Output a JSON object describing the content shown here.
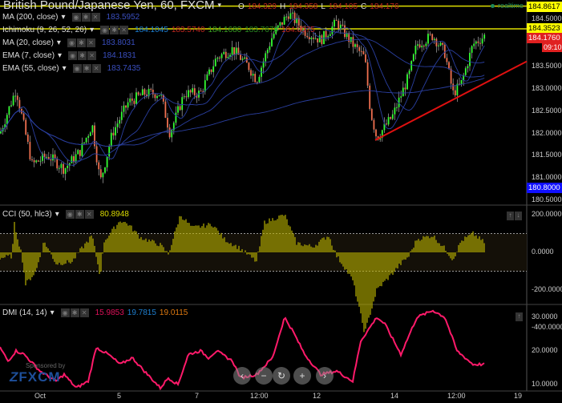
{
  "title": "British Pound/Japanese Yen, 60, FXCM",
  "ohlc": {
    "o_label": "O",
    "o": "184.329",
    "h_label": "H",
    "h": "184.358",
    "l_label": "L",
    "l": "184.105",
    "c_label": "C",
    "c": "184.176"
  },
  "realtime": "realtime",
  "indicators": [
    {
      "name": "MA (200, close)",
      "values": [
        "183.5952"
      ],
      "colors": [
        "#3a4fc0"
      ]
    },
    {
      "name": "Ichimoku (9, 26, 52, 26)",
      "values": [
        "184.1045",
        "183.5740",
        "184.1680",
        "183.7678",
        "184.0975"
      ],
      "colors": [
        "#1e7fd0",
        "#c0281e",
        "#3aa020",
        "#2a8a20",
        "#c0281e"
      ]
    },
    {
      "name": "MA (20, close)",
      "values": [
        "183.8031"
      ],
      "colors": [
        "#3a4fc0"
      ]
    },
    {
      "name": "EMA (7, close)",
      "values": [
        "184.1831"
      ],
      "colors": [
        "#3a4fc0"
      ]
    },
    {
      "name": "EMA (55, close)",
      "values": [
        "183.7435"
      ],
      "colors": [
        "#3a4fc0"
      ]
    }
  ],
  "price_axis": [
    "184.5000",
    "183.5000",
    "183.0000",
    "182.5000",
    "182.0000",
    "181.5000",
    "181.0000",
    "180.5000"
  ],
  "price_tags": {
    "high_line": "184.8617",
    "resistance": "184.3523",
    "last": "184.1760",
    "countdown": "09:10",
    "low": "180.8000"
  },
  "cci": {
    "name": "CCI (50, hlc3)",
    "value": "80.8948",
    "axis": [
      "200.0000",
      "0.0000",
      "-200.0000",
      "-400.0000"
    ]
  },
  "dmi": {
    "name": "DMI (14, 14)",
    "values": [
      "15.9853",
      "19.7815",
      "19.0115"
    ],
    "colors": [
      "#e0105a",
      "#1e7fd0",
      "#e07a10"
    ],
    "axis": [
      "30.0000",
      "20.0000",
      "10.0000"
    ]
  },
  "x_axis": [
    "Oct",
    "5",
    "7",
    "12:00",
    "12",
    "14",
    "12:00",
    "19"
  ],
  "sponsor": {
    "text": "Sponsored by",
    "brand": "FXCM"
  },
  "nav_buttons": [
    "‹",
    "−",
    "↻",
    "+",
    "›"
  ],
  "chart_data": {
    "type": "candlestick",
    "price_close": [
      [
        0,
        182
      ],
      [
        20,
        183
      ],
      [
        40,
        181.3
      ],
      [
        60,
        181.5
      ],
      [
        80,
        181.2
      ],
      [
        100,
        181.6
      ],
      [
        115,
        182.2
      ],
      [
        125,
        180.9
      ],
      [
        140,
        182
      ],
      [
        160,
        182.7
      ],
      [
        180,
        182.9
      ],
      [
        200,
        182.9
      ],
      [
        212,
        182
      ],
      [
        230,
        182.9
      ],
      [
        250,
        182.9
      ],
      [
        270,
        183.7
      ],
      [
        290,
        183.9
      ],
      [
        310,
        183.5
      ],
      [
        320,
        183.2
      ],
      [
        340,
        184.2
      ],
      [
        360,
        184.7
      ],
      [
        380,
        184.3
      ],
      [
        400,
        184.1
      ],
      [
        420,
        184.5
      ],
      [
        440,
        184
      ],
      [
        455,
        183.7
      ],
      [
        462,
        182.5
      ],
      [
        470,
        181.9
      ],
      [
        490,
        182.4
      ],
      [
        510,
        183.3
      ],
      [
        520,
        184
      ],
      [
        540,
        184.2
      ],
      [
        555,
        183.8
      ],
      [
        565,
        182.9
      ],
      [
        575,
        183.1
      ],
      [
        590,
        184
      ],
      [
        605,
        184.2
      ]
    ],
    "cci_values": [
      [
        0,
        -30
      ],
      [
        15,
        -20
      ],
      [
        18,
        150
      ],
      [
        27,
        -10
      ],
      [
        32,
        -170
      ],
      [
        45,
        -100
      ],
      [
        55,
        60
      ],
      [
        70,
        -60
      ],
      [
        90,
        -50
      ],
      [
        100,
        10
      ],
      [
        115,
        90
      ],
      [
        125,
        -130
      ],
      [
        130,
        60
      ],
      [
        150,
        170
      ],
      [
        160,
        150
      ],
      [
        175,
        80
      ],
      [
        200,
        40
      ],
      [
        210,
        -10
      ],
      [
        225,
        200
      ],
      [
        240,
        130
      ],
      [
        265,
        150
      ],
      [
        280,
        70
      ],
      [
        300,
        20
      ],
      [
        320,
        -50
      ],
      [
        330,
        160
      ],
      [
        355,
        200
      ],
      [
        370,
        50
      ],
      [
        390,
        30
      ],
      [
        410,
        90
      ],
      [
        420,
        -20
      ],
      [
        430,
        -80
      ],
      [
        440,
        -150
      ],
      [
        447,
        -280
      ],
      [
        455,
        -430
      ],
      [
        470,
        -200
      ],
      [
        490,
        -110
      ],
      [
        500,
        -60
      ],
      [
        510,
        -20
      ],
      [
        520,
        70
      ],
      [
        540,
        90
      ],
      [
        555,
        20
      ],
      [
        565,
        -40
      ],
      [
        575,
        60
      ],
      [
        590,
        100
      ],
      [
        605,
        50
      ]
    ],
    "dmi_values": [
      [
        0,
        21
      ],
      [
        10,
        17
      ],
      [
        20,
        20
      ],
      [
        30,
        19
      ],
      [
        50,
        14
      ],
      [
        70,
        11
      ],
      [
        80,
        13
      ],
      [
        95,
        9
      ],
      [
        110,
        11
      ],
      [
        120,
        21
      ],
      [
        135,
        19
      ],
      [
        150,
        16
      ],
      [
        165,
        18
      ],
      [
        180,
        14
      ],
      [
        200,
        9
      ],
      [
        210,
        12
      ],
      [
        222,
        10
      ],
      [
        235,
        19
      ],
      [
        250,
        20
      ],
      [
        260,
        18
      ],
      [
        270,
        20
      ],
      [
        290,
        17
      ],
      [
        300,
        12
      ],
      [
        320,
        13
      ],
      [
        340,
        18
      ],
      [
        355,
        30
      ],
      [
        365,
        26
      ],
      [
        380,
        19
      ],
      [
        400,
        13
      ],
      [
        420,
        14
      ],
      [
        440,
        11
      ],
      [
        450,
        23
      ],
      [
        470,
        30
      ],
      [
        480,
        28
      ],
      [
        500,
        19
      ],
      [
        520,
        30
      ],
      [
        540,
        32
      ],
      [
        555,
        30
      ],
      [
        570,
        20
      ],
      [
        590,
        16
      ],
      [
        605,
        16
      ]
    ],
    "trendline": [
      [
        468,
        181.85
      ],
      [
        657,
        183.62
      ]
    ],
    "horizontal_lines": [
      184.8617,
      184.3523
    ]
  }
}
